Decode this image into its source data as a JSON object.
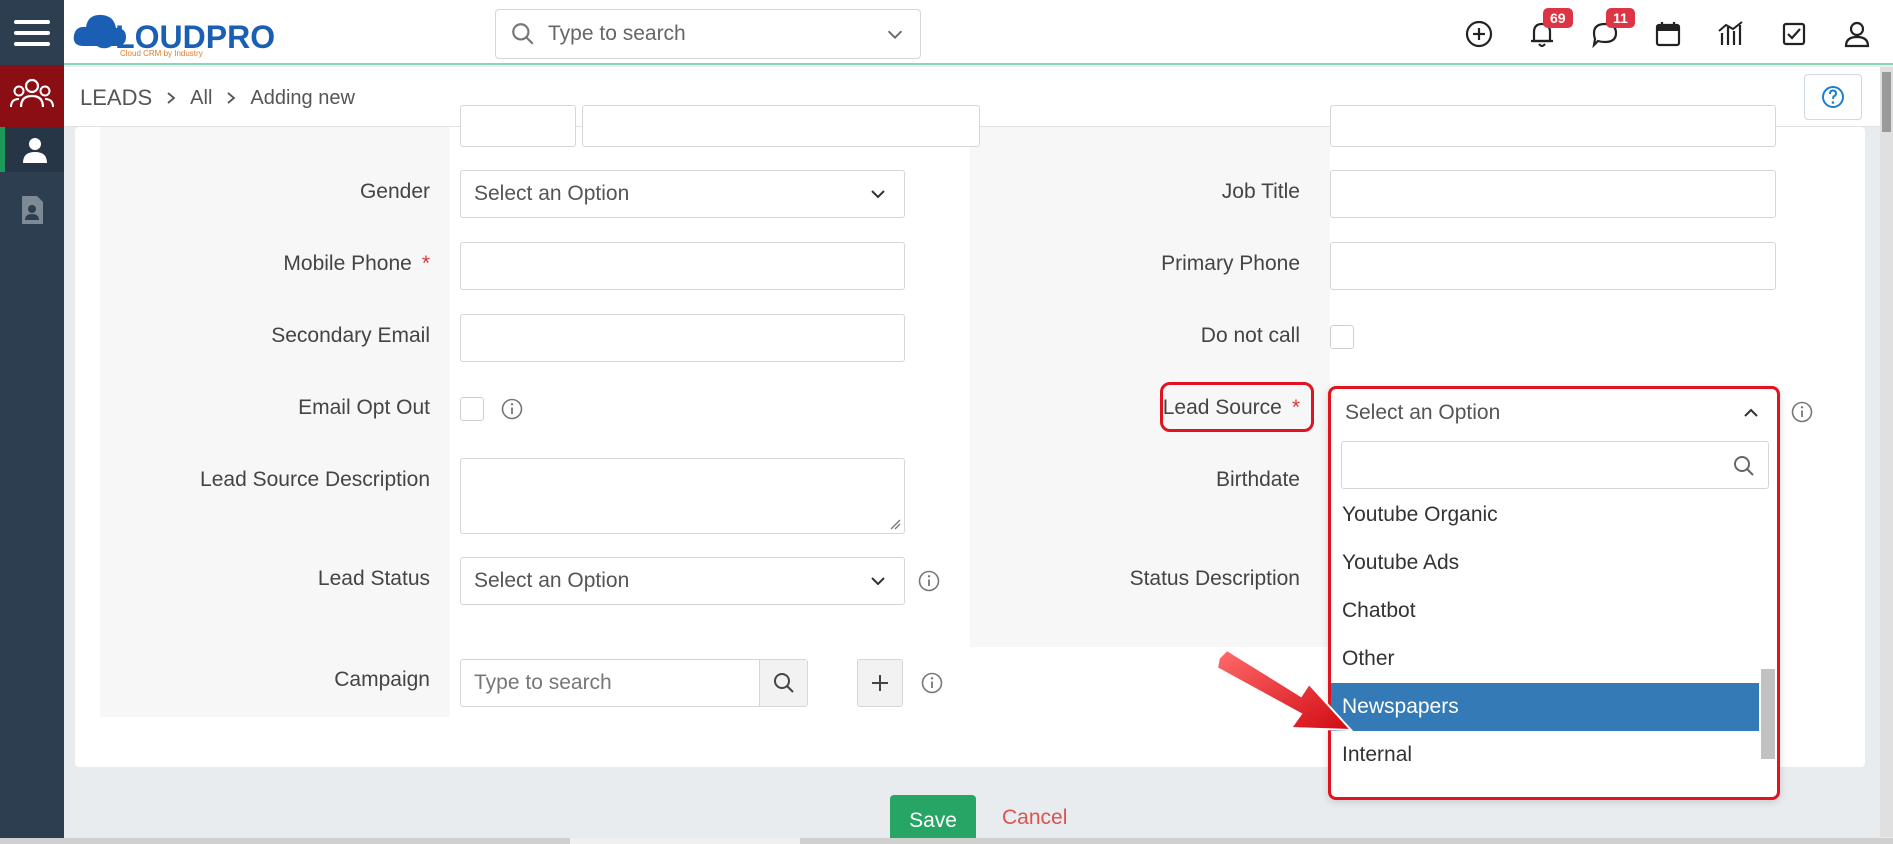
{
  "app": {
    "logo_text": "CLOUDPRO",
    "logo_tagline": "Cloud CRM by Industry"
  },
  "header": {
    "search_placeholder": "Type to search",
    "notifications_count": "69",
    "messages_count": "11"
  },
  "breadcrumb": {
    "module": "LEADS",
    "filter": "All",
    "current": "Adding new"
  },
  "form": {
    "left": {
      "gender_label": "Gender",
      "gender_value": "Select an Option",
      "mobile_label": "Mobile Phone",
      "required_mark": "*",
      "secondary_email_label": "Secondary Email",
      "email_opt_out_label": "Email Opt Out",
      "lead_source_desc_label": "Lead Source Description",
      "lead_status_label": "Lead Status",
      "lead_status_value": "Select an Option",
      "campaign_label": "Campaign",
      "campaign_placeholder": "Type to search"
    },
    "right": {
      "job_title_label": "Job Title",
      "primary_phone_label": "Primary Phone",
      "do_not_call_label": "Do not call",
      "lead_source_label": "Lead Source",
      "lead_source_value": "Select an Option",
      "birthdate_label": "Birthdate",
      "status_desc_label": "Status Description"
    }
  },
  "dropdown": {
    "options": [
      "Youtube Organic",
      "Youtube Ads",
      "Chatbot",
      "Other",
      "Newspapers",
      "Internal"
    ],
    "highlighted_index": 4
  },
  "footer": {
    "save_label": "Save",
    "cancel_label": "Cancel"
  },
  "colors": {
    "sidebar": "#2c3e50",
    "active_module": "#8b0e14",
    "accent_blue": "#337ab7",
    "save_green": "#27a565",
    "highlight_red": "#e0141e",
    "badge_red": "#dc3545"
  }
}
